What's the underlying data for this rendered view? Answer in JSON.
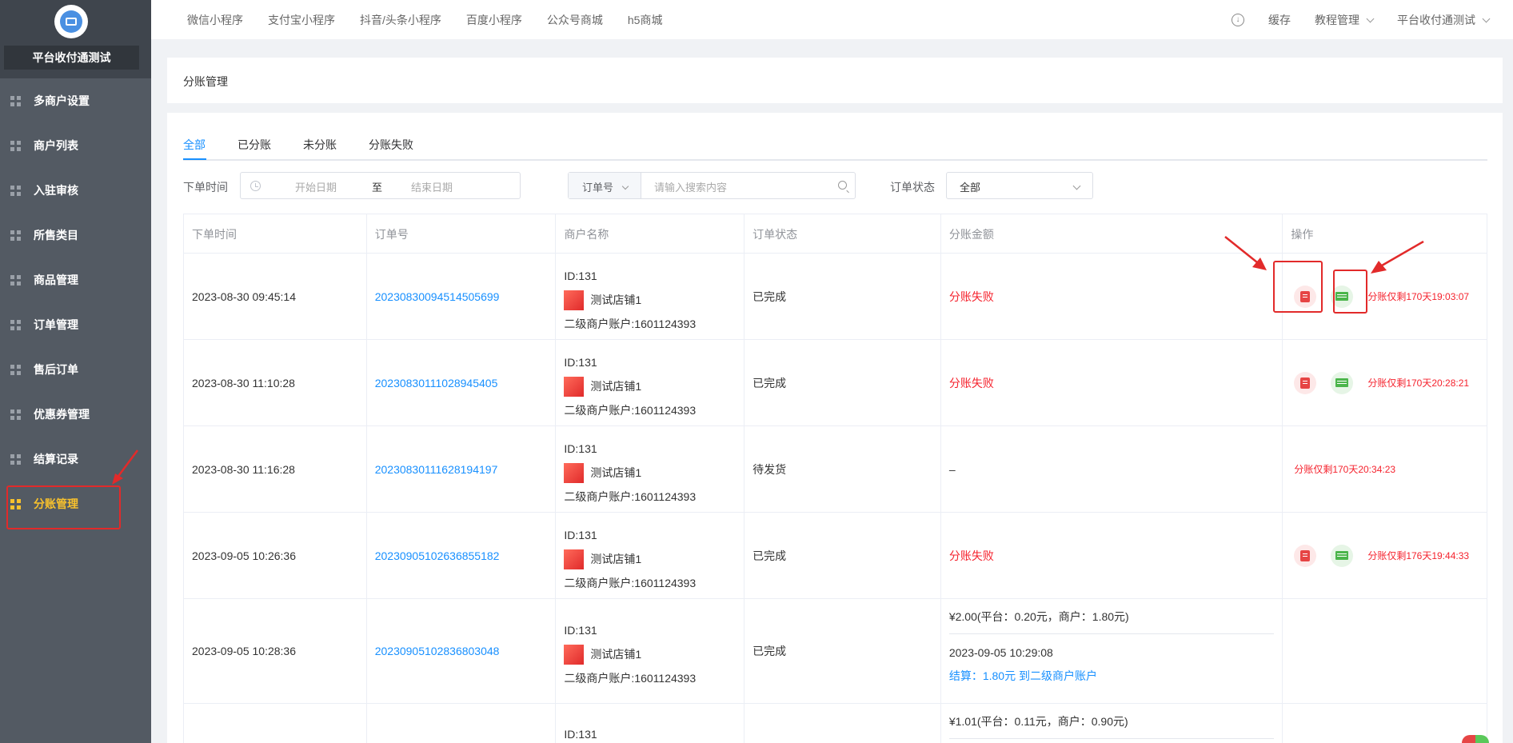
{
  "sidebar": {
    "shop_name": "平台收付通测试",
    "items": [
      {
        "label": "多商户设置"
      },
      {
        "label": "商户列表"
      },
      {
        "label": "入驻审核"
      },
      {
        "label": "所售类目"
      },
      {
        "label": "商品管理"
      },
      {
        "label": "订单管理"
      },
      {
        "label": "售后订单"
      },
      {
        "label": "优惠券管理"
      },
      {
        "label": "结算记录"
      },
      {
        "label": "分账管理"
      }
    ],
    "active_index": 9,
    "active_color": "#f7c12d"
  },
  "topbar": {
    "nav": [
      "微信小程序",
      "支付宝小程序",
      "抖音/头条小程序",
      "百度小程序",
      "公众号商城",
      "h5商城"
    ],
    "download_icon": "download-icon",
    "cache": "缓存",
    "tutorial": "教程管理",
    "account": "平台收付通测试"
  },
  "page": {
    "title": "分账管理"
  },
  "tabs": [
    "全部",
    "已分账",
    "未分账",
    "分账失败"
  ],
  "filters": {
    "order_time_label": "下单时间",
    "start_placeholder": "开始日期",
    "range_sep": "至",
    "end_placeholder": "结束日期",
    "search_type": "订单号",
    "search_placeholder": "请输入搜索内容",
    "status_label": "订单状态",
    "status_value": "全部"
  },
  "table": {
    "headers": [
      "下单时间",
      "订单号",
      "商户名称",
      "订单状态",
      "分账金额",
      "操作"
    ],
    "rows": [
      {
        "time": "2023-08-30 09:45:14",
        "order_no": "20230830094514505699",
        "merchant_id": "ID:131",
        "shop": "测试店铺1",
        "sub_account": "二级商户账户:1601124393",
        "status": "已完成",
        "amount": "分账失败",
        "countdown": "分账仅剩170天19:03:07"
      },
      {
        "time": "2023-08-30 11:10:28",
        "order_no": "20230830111028945405",
        "merchant_id": "ID:131",
        "shop": "测试店铺1",
        "sub_account": "二级商户账户:1601124393",
        "status": "已完成",
        "amount": "分账失败",
        "countdown": "分账仅剩170天20:28:21"
      },
      {
        "time": "2023-08-30 11:16:28",
        "order_no": "20230830111628194197",
        "merchant_id": "ID:131",
        "shop": "测试店铺1",
        "sub_account": "二级商户账户:1601124393",
        "status": "待发货",
        "amount": "–",
        "countdown": "分账仅剩170天20:34:23"
      },
      {
        "time": "2023-09-05 10:26:36",
        "order_no": "20230905102636855182",
        "merchant_id": "ID:131",
        "shop": "测试店铺1",
        "sub_account": "二级商户账户:1601124393",
        "status": "已完成",
        "amount": "分账失败",
        "countdown": "分账仅剩176天19:44:33"
      },
      {
        "time": "2023-09-05 10:28:36",
        "order_no": "20230905102836803048",
        "merchant_id": "ID:131",
        "shop": "测试店铺1",
        "sub_account": "二级商户账户:1601124393",
        "status": "已完成",
        "amount_detail": "¥2.00(平台：0.20元，商户：1.80元)",
        "settle_time": "2023-09-05 10:29:08",
        "settle_text": "结算：1.80元 到二级商户账户"
      },
      {
        "merchant_id": "ID:131",
        "amount_detail": "¥1.01(平台：0.11元，商户：0.90元)"
      }
    ]
  },
  "colors": {
    "accent": "#1890ff",
    "danger": "#f5222d",
    "highlight": "#e22a2a"
  }
}
